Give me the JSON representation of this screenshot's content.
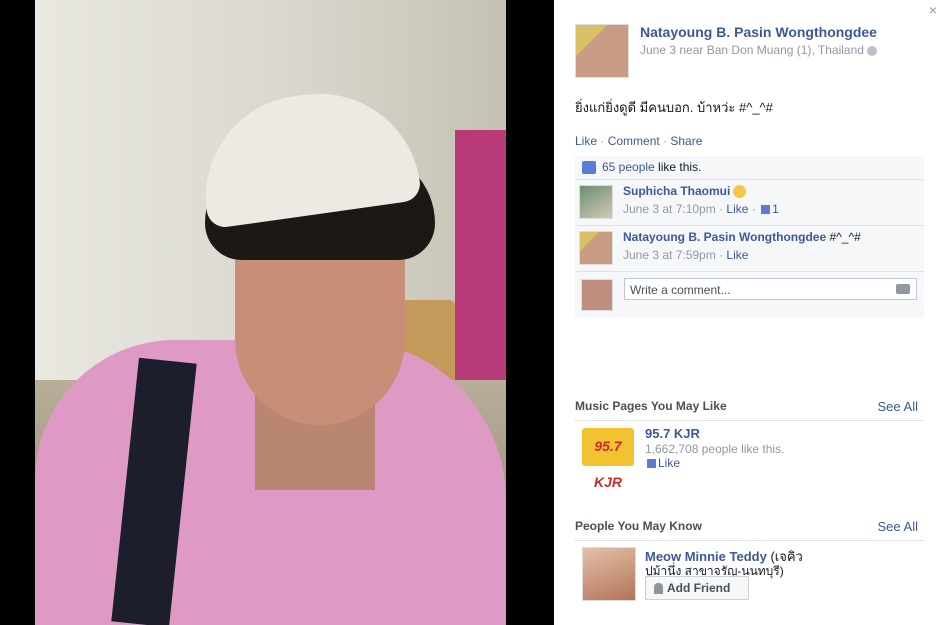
{
  "close_label": "×",
  "post": {
    "owner_name": "Natayoung B. Pasin Wongthongdee",
    "meta": "June 3 near Ban Don Muang (1), Thailand",
    "caption": "ยิ่งแก่ยิ่งดูดี มีคนบอก. บ้าหว่ะ #^_^#",
    "actions": {
      "like": "Like",
      "comment": "Comment",
      "share": "Share",
      "sep": " · "
    },
    "likes_count_link": "65 people",
    "likes_suffix": " like this."
  },
  "comments": [
    {
      "author": "Suphicha Thaomui",
      "text": "",
      "emoji": "smile-emoji",
      "time": "June 3 at 7:10pm",
      "like_label": "Like",
      "like_count": "1"
    },
    {
      "author": "Natayoung B. Pasin Wongthongdee",
      "text": "#^_^#",
      "time": "June 3 at 7:59pm",
      "like_label": "Like"
    }
  ],
  "write_comment": {
    "placeholder": "Write a comment..."
  },
  "music_pages": {
    "title": "Music Pages You May Like",
    "see_all": "See All",
    "page": {
      "logo_text": "95.7 KJR",
      "name": "95.7 KJR",
      "likes": "1,662,708 people like this.",
      "like_label": "Like"
    }
  },
  "people_you_may_know": {
    "title": "People You May Know",
    "see_all": "See All",
    "person": {
      "name": "Meow Minnie Teddy",
      "name_extra": "(เจคิว",
      "subline": "ปูม้านึ่ง สาขาจรัญ-นนทบุรี)",
      "button": "Add Friend"
    }
  }
}
